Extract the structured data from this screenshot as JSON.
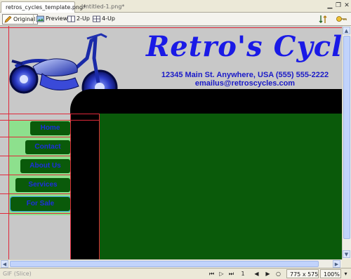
{
  "tabs": [
    {
      "label": "retros_cycles_template.png*",
      "active": true
    },
    {
      "label": "Untitled-1.png*",
      "active": false
    }
  ],
  "toolbar": {
    "original_label": "Original",
    "preview_label": "Preview",
    "two_up_label": "2-Up",
    "four_up_label": "4-Up"
  },
  "site": {
    "title": "Retro's Cycles",
    "address": "12345 Main St. Anywhere, USA (555) 555-2222",
    "email": "emailus@retroscycles.com",
    "nav": [
      "Home",
      "Contact",
      "About Us",
      "Services",
      "For Sale"
    ],
    "colors": {
      "title_blue": "#1a1ae6",
      "nav_text": "#1d2ee0",
      "green": "#0a5a0a",
      "nav_bg": "#8de08d",
      "guides": "#e0283a"
    }
  },
  "status": {
    "format": "GIF (Slice)",
    "frame": "1",
    "dimensions": "775 x 575",
    "zoom": "100%"
  }
}
